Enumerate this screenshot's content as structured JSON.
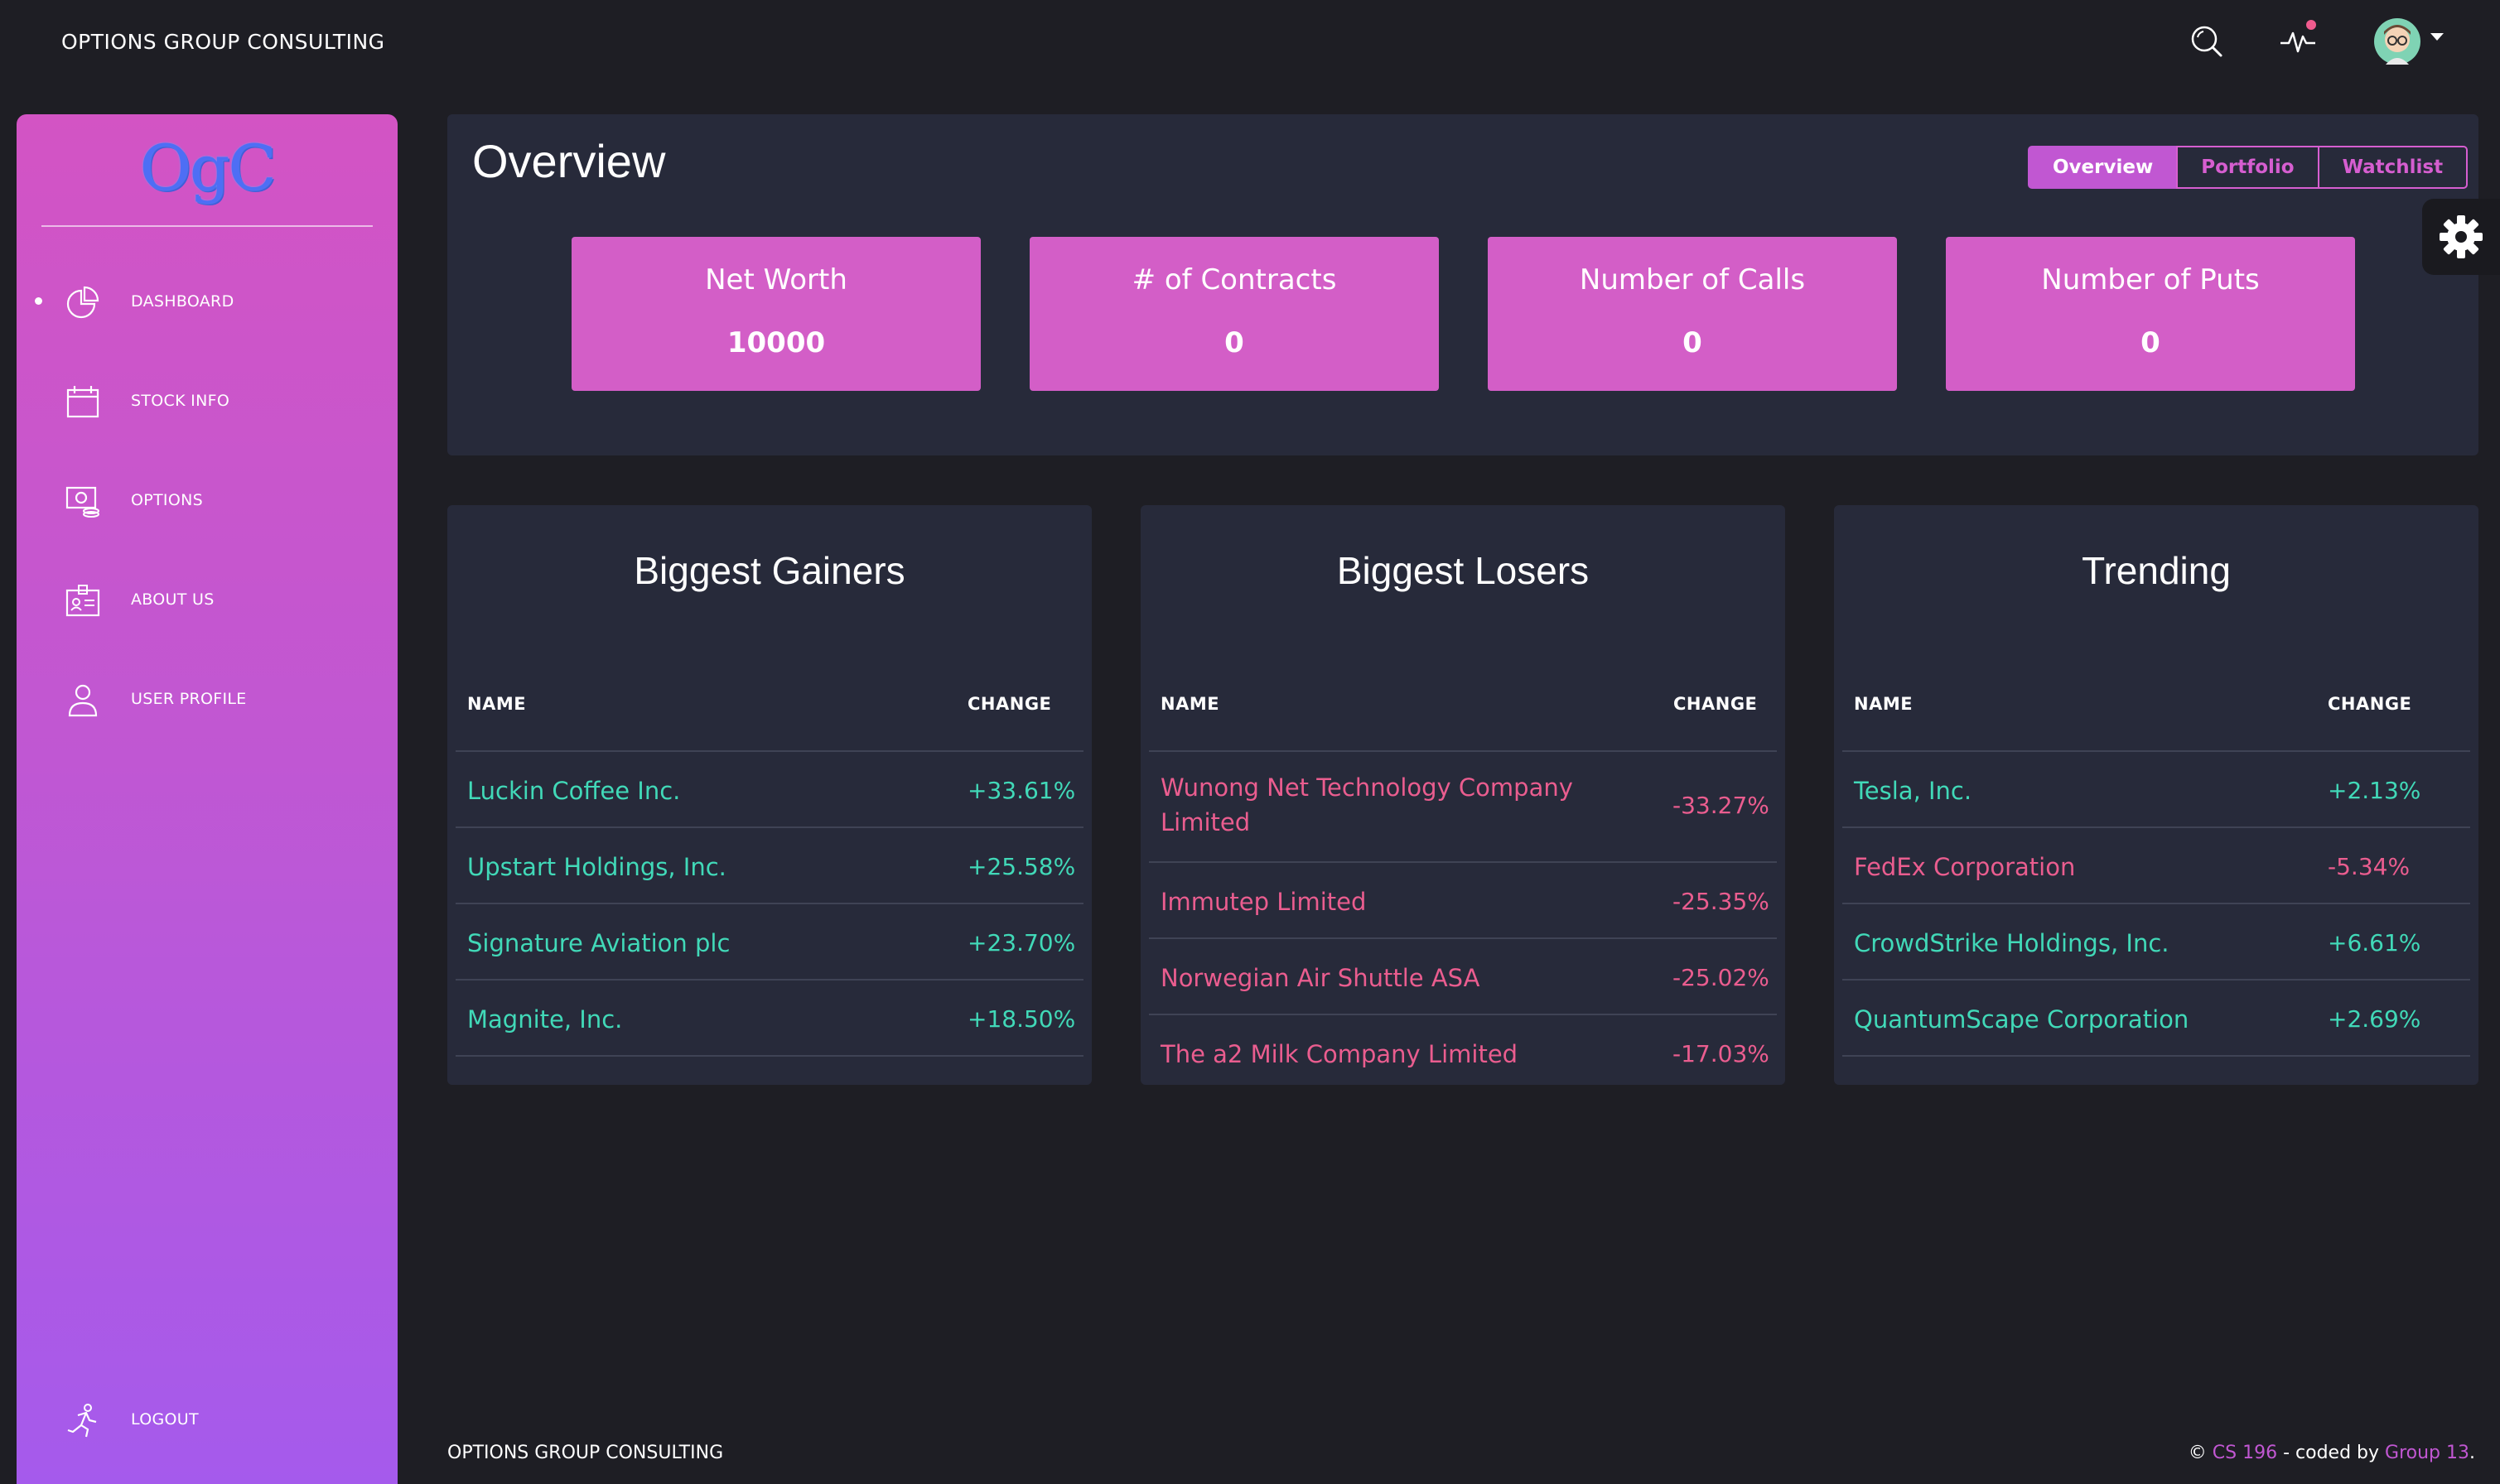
{
  "navbar": {
    "brand": "OPTIONS GROUP CONSULTING",
    "icons": [
      "search-icon",
      "activity-icon",
      "avatar-icon"
    ]
  },
  "sidebar": {
    "logo": "OgC",
    "items": [
      {
        "label": "DASHBOARD",
        "icon": "pie-chart-icon",
        "active": true
      },
      {
        "label": "STOCK INFO",
        "icon": "calendar-icon",
        "active": false
      },
      {
        "label": "OPTIONS",
        "icon": "money-icon",
        "active": false
      },
      {
        "label": "ABOUT US",
        "icon": "id-card-icon",
        "active": false
      },
      {
        "label": "USER PROFILE",
        "icon": "user-icon",
        "active": false
      }
    ],
    "logout": {
      "label": "LOGOUT",
      "icon": "running-icon"
    }
  },
  "overview": {
    "title": "Overview",
    "tabs": [
      {
        "label": "Overview",
        "active": true
      },
      {
        "label": "Portfolio",
        "active": false
      },
      {
        "label": "Watchlist",
        "active": false
      }
    ],
    "stats": [
      {
        "title": "Net Worth",
        "value": "10000"
      },
      {
        "title": "# of Contracts",
        "value": "0"
      },
      {
        "title": "Number of Calls",
        "value": "0"
      },
      {
        "title": "Number of Puts",
        "value": "0"
      }
    ]
  },
  "tables": [
    {
      "title": "Biggest Gainers",
      "col_name": "NAME",
      "col_change": "CHANGE",
      "rows": [
        {
          "name": "Luckin Coffee Inc.",
          "change": "+33.61%",
          "trend": "gain"
        },
        {
          "name": "Upstart Holdings, Inc.",
          "change": "+25.58%",
          "trend": "gain"
        },
        {
          "name": "Signature Aviation plc",
          "change": "+23.70%",
          "trend": "gain"
        },
        {
          "name": "Magnite, Inc.",
          "change": "+18.50%",
          "trend": "gain"
        }
      ]
    },
    {
      "title": "Biggest Losers",
      "col_name": "NAME",
      "col_change": "CHANGE",
      "rows": [
        {
          "name_line1": "Wunong Net Technology Company",
          "name_line2": "Limited",
          "change": "-33.27%",
          "trend": "loss"
        },
        {
          "name": "Immutep Limited",
          "change": "-25.35%",
          "trend": "loss"
        },
        {
          "name": "Norwegian Air Shuttle ASA",
          "change": "-25.02%",
          "trend": "loss"
        },
        {
          "name": "The a2 Milk Company Limited",
          "change": "-17.03%",
          "trend": "loss"
        }
      ]
    },
    {
      "title": "Trending",
      "col_name": "NAME",
      "col_change": "CHANGE",
      "rows": [
        {
          "name": "Tesla, Inc.",
          "change": "+2.13%",
          "trend": "gain"
        },
        {
          "name": "FedEx Corporation",
          "change": "-5.34%",
          "trend": "loss"
        },
        {
          "name": "CrowdStrike Holdings, Inc.",
          "change": "+6.61%",
          "trend": "gain"
        },
        {
          "name": "QuantumScape Corporation",
          "change": "+2.69%",
          "trend": "gain"
        }
      ]
    }
  ],
  "footer": {
    "left": "OPTIONS GROUP CONSULTING",
    "copyright": "©",
    "course": "CS 196",
    "coded_by": " - coded by ",
    "group": "Group 13",
    "end": "."
  },
  "colors": {
    "accent": "#c157d2",
    "gain": "#41d9b8",
    "loss": "#ea5d8f",
    "panel": "#272a3a",
    "background": "#1e1e24"
  }
}
